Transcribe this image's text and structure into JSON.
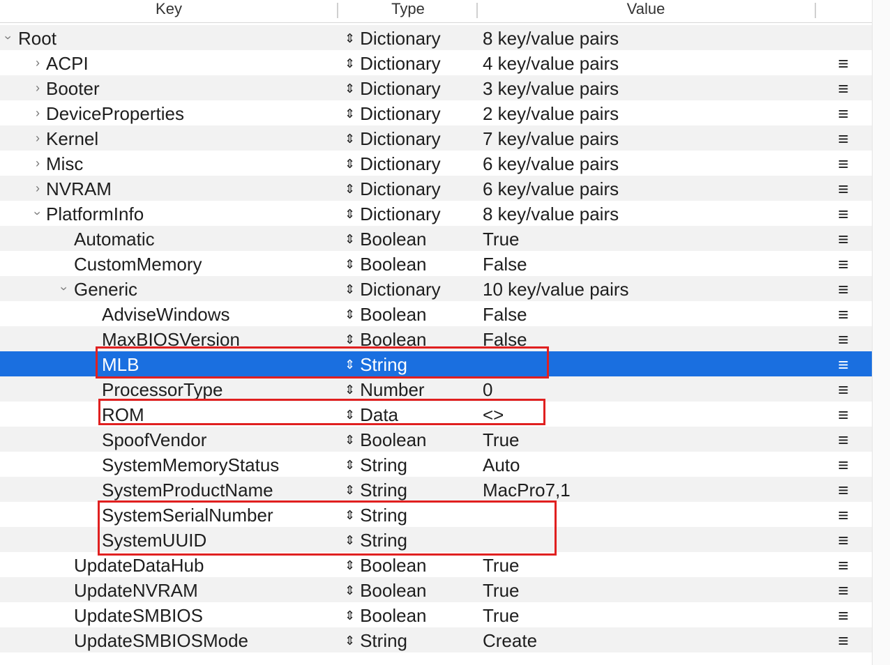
{
  "columns": {
    "key": "Key",
    "type": "Type",
    "value": "Value"
  },
  "rows": [
    {
      "key": "Root",
      "type": "Dictionary",
      "value": "8 key/value pairs",
      "level": 0,
      "disclosure": "open",
      "menu": false
    },
    {
      "key": "ACPI",
      "type": "Dictionary",
      "value": "4 key/value pairs",
      "level": 1,
      "disclosure": "closed",
      "menu": true
    },
    {
      "key": "Booter",
      "type": "Dictionary",
      "value": "3 key/value pairs",
      "level": 1,
      "disclosure": "closed",
      "menu": true
    },
    {
      "key": "DeviceProperties",
      "type": "Dictionary",
      "value": "2 key/value pairs",
      "level": 1,
      "disclosure": "closed",
      "menu": true
    },
    {
      "key": "Kernel",
      "type": "Dictionary",
      "value": "7 key/value pairs",
      "level": 1,
      "disclosure": "closed",
      "menu": true
    },
    {
      "key": "Misc",
      "type": "Dictionary",
      "value": "6 key/value pairs",
      "level": 1,
      "disclosure": "closed",
      "menu": true
    },
    {
      "key": "NVRAM",
      "type": "Dictionary",
      "value": "6 key/value pairs",
      "level": 1,
      "disclosure": "closed",
      "menu": true
    },
    {
      "key": "PlatformInfo",
      "type": "Dictionary",
      "value": "8 key/value pairs",
      "level": 1,
      "disclosure": "open",
      "menu": true
    },
    {
      "key": "Automatic",
      "type": "Boolean",
      "value": "True",
      "level": 2,
      "disclosure": "none",
      "menu": true
    },
    {
      "key": "CustomMemory",
      "type": "Boolean",
      "value": "False",
      "level": 2,
      "disclosure": "none",
      "menu": true
    },
    {
      "key": "Generic",
      "type": "Dictionary",
      "value": "10 key/value pairs",
      "level": 2,
      "disclosure": "open",
      "menu": true
    },
    {
      "key": "AdviseWindows",
      "type": "Boolean",
      "value": "False",
      "level": 3,
      "disclosure": "none",
      "menu": true
    },
    {
      "key": "MaxBIOSVersion",
      "type": "Boolean",
      "value": "False",
      "level": 3,
      "disclosure": "none",
      "menu": true
    },
    {
      "key": "MLB",
      "type": "String",
      "value": "",
      "level": 3,
      "disclosure": "none",
      "menu": true,
      "selected": true
    },
    {
      "key": "ProcessorType",
      "type": "Number",
      "value": "0",
      "level": 3,
      "disclosure": "none",
      "menu": true
    },
    {
      "key": "ROM",
      "type": "Data",
      "value": "<>",
      "level": 3,
      "disclosure": "none",
      "menu": true
    },
    {
      "key": "SpoofVendor",
      "type": "Boolean",
      "value": "True",
      "level": 3,
      "disclosure": "none",
      "menu": true
    },
    {
      "key": "SystemMemoryStatus",
      "type": "String",
      "value": "Auto",
      "level": 3,
      "disclosure": "none",
      "menu": true
    },
    {
      "key": "SystemProductName",
      "type": "String",
      "value": "MacPro7,1",
      "level": 3,
      "disclosure": "none",
      "menu": true
    },
    {
      "key": "SystemSerialNumber",
      "type": "String",
      "value": "",
      "level": 3,
      "disclosure": "none",
      "menu": true
    },
    {
      "key": "SystemUUID",
      "type": "String",
      "value": "",
      "level": 3,
      "disclosure": "none",
      "menu": true
    },
    {
      "key": "UpdateDataHub",
      "type": "Boolean",
      "value": "True",
      "level": 2,
      "disclosure": "none",
      "menu": true
    },
    {
      "key": "UpdateNVRAM",
      "type": "Boolean",
      "value": "True",
      "level": 2,
      "disclosure": "none",
      "menu": true
    },
    {
      "key": "UpdateSMBIOS",
      "type": "Boolean",
      "value": "True",
      "level": 2,
      "disclosure": "none",
      "menu": true
    },
    {
      "key": "UpdateSMBIOSMode",
      "type": "String",
      "value": "Create",
      "level": 2,
      "disclosure": "none",
      "menu": true
    }
  ],
  "glyphs": {
    "type_arrows": "⇕",
    "menu": "≡",
    "disclosure": "›"
  },
  "colors": {
    "selection": "#1a6fe0",
    "highlight_box": "#e02020",
    "alt_row": "#f2f2f2"
  }
}
